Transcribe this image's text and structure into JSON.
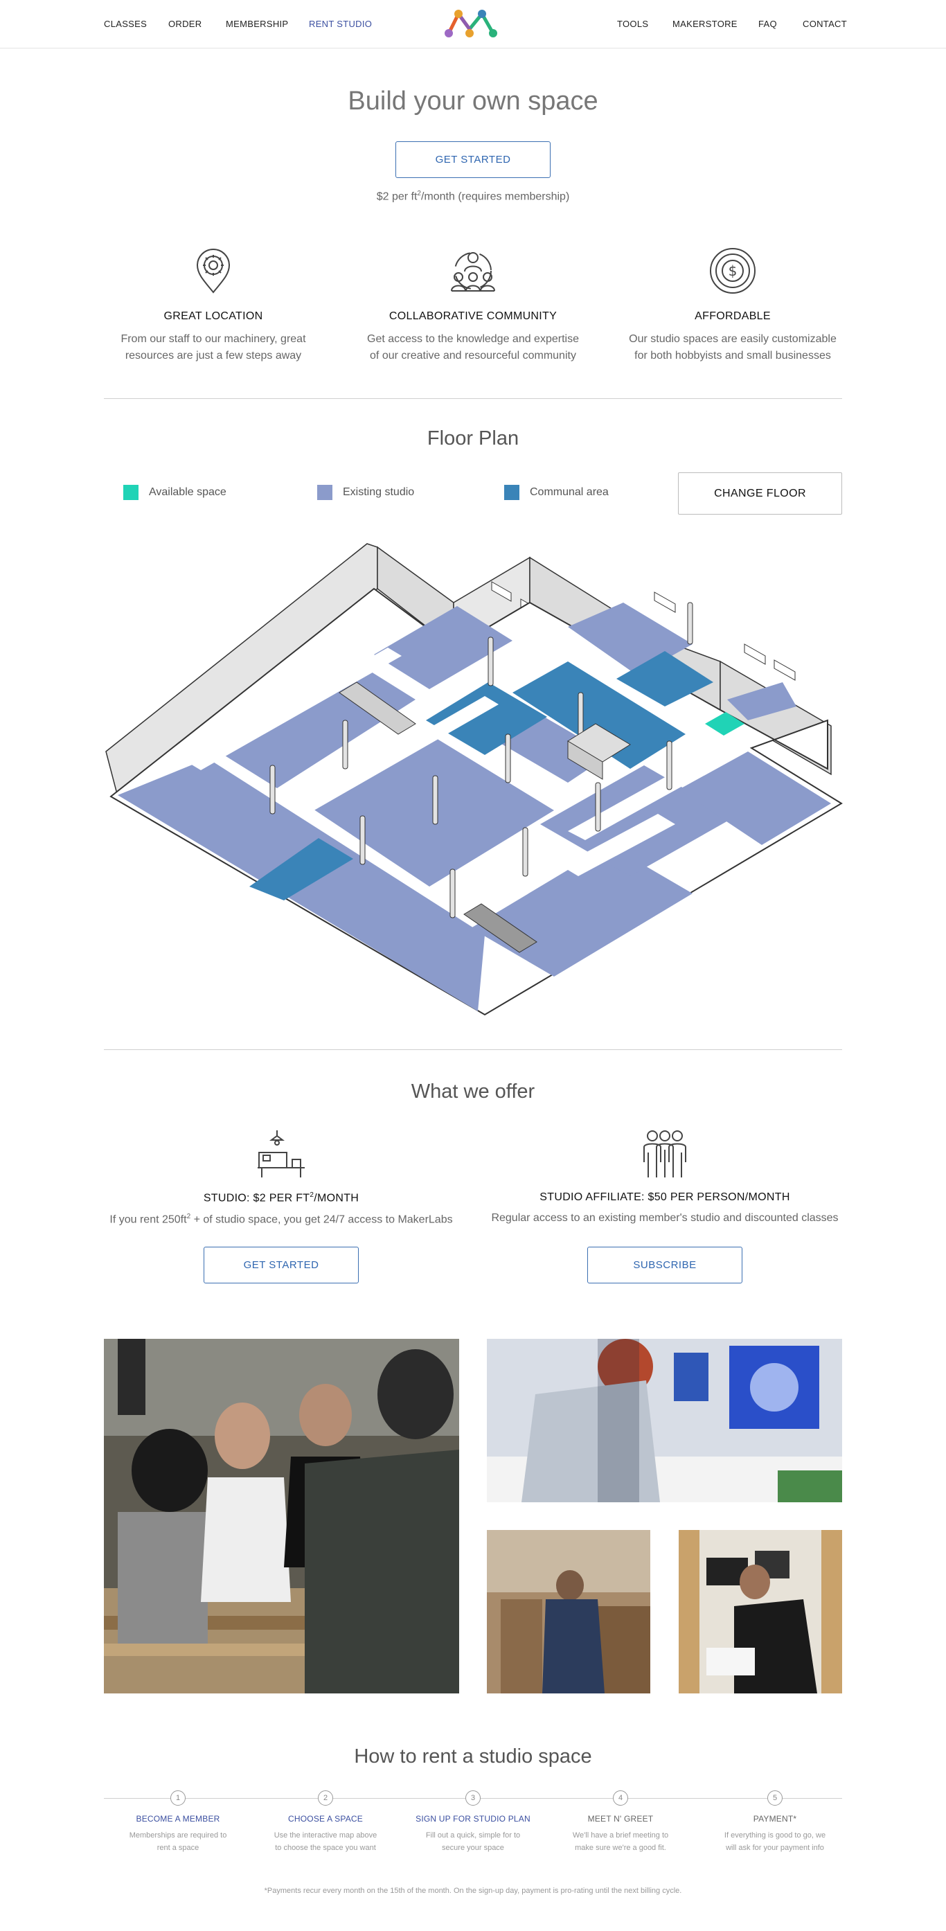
{
  "nav": {
    "left": [
      "CLASSES",
      "ORDER",
      "MEMBERSHIP",
      "RENT STUDIO"
    ],
    "right": [
      "TOOLS",
      "MAKERSTORE",
      "FAQ",
      "CONTACT"
    ]
  },
  "hero": {
    "title": "Build your own space",
    "cta": "GET STARTED",
    "price_prefix": "$2 per ft",
    "price_sup": "2",
    "price_suffix": "/month (requires membership)"
  },
  "features": [
    {
      "icon": "location-pin-icon",
      "title": "GREAT LOCATION",
      "line1": "From our staff to our machinery, great",
      "line2": "resources are just a few steps away"
    },
    {
      "icon": "community-icon",
      "title": "COLLABORATIVE COMMUNITY",
      "line1": "Get access to the knowledge and expertise",
      "line2": "of our creative and resourceful community"
    },
    {
      "icon": "dollar-coin-icon",
      "title": "AFFORDABLE",
      "line1": "Our studio spaces are easily customizable",
      "line2": "for both hobbyists and small businesses"
    }
  ],
  "floor_plan": {
    "title": "Floor Plan",
    "legend": [
      {
        "label": "Available space",
        "color": "#20d3b6"
      },
      {
        "label": "Existing studio",
        "color": "#8b9bcb"
      },
      {
        "label": "Communal area",
        "color": "#3a84b8"
      }
    ],
    "change_floor": "CHANGE FLOOR"
  },
  "offer": {
    "title": "What we offer",
    "items": [
      {
        "icon": "workbench-icon",
        "title_prefix": "STUDIO: $2 PER FT",
        "title_sup": "2",
        "title_suffix": "/MONTH",
        "desc_prefix": "If you rent 250ft",
        "desc_sup": "2",
        "desc_suffix": " + of studio space, you get 24/7 access to MakerLabs",
        "cta": "GET STARTED"
      },
      {
        "icon": "group-icon",
        "title_prefix": "STUDIO AFFILIATE: $50 PER PERSON/MONTH",
        "title_sup": "",
        "title_suffix": "",
        "desc_prefix": "Regular access to an existing member's studio and discounted classes",
        "desc_sup": "",
        "desc_suffix": "",
        "cta": "SUBSCRIBE"
      }
    ]
  },
  "how_to": {
    "title": "How to rent a studio space",
    "steps": [
      {
        "num": "1",
        "title": "BECOME A MEMBER",
        "line1": "Memberships are required to",
        "line2": "rent a space",
        "color": "#3b4fa0"
      },
      {
        "num": "2",
        "title": "CHOOSE A SPACE",
        "line1": "Use the interactive map above",
        "line2": "to choose the space you want",
        "color": "#3b4fa0"
      },
      {
        "num": "3",
        "title": "SIGN UP FOR STUDIO PLAN",
        "line1": "Fill out a quick, simple for to",
        "line2": "secure your space",
        "color": "#3b4fa0"
      },
      {
        "num": "4",
        "title": "MEET N' GREET",
        "line1": "We'll have a brief meeting to",
        "line2": "make sure we're a good fit.",
        "color": "#666666"
      },
      {
        "num": "5",
        "title": "PAYMENT*",
        "line1": "If everything is good to go, we",
        "line2": "will ask for your payment info",
        "color": "#666666"
      }
    ],
    "footnote": "*Payments recur every month on the 15th of the month. On the sign-up day, payment is pro-rating until the next billing cycle."
  }
}
